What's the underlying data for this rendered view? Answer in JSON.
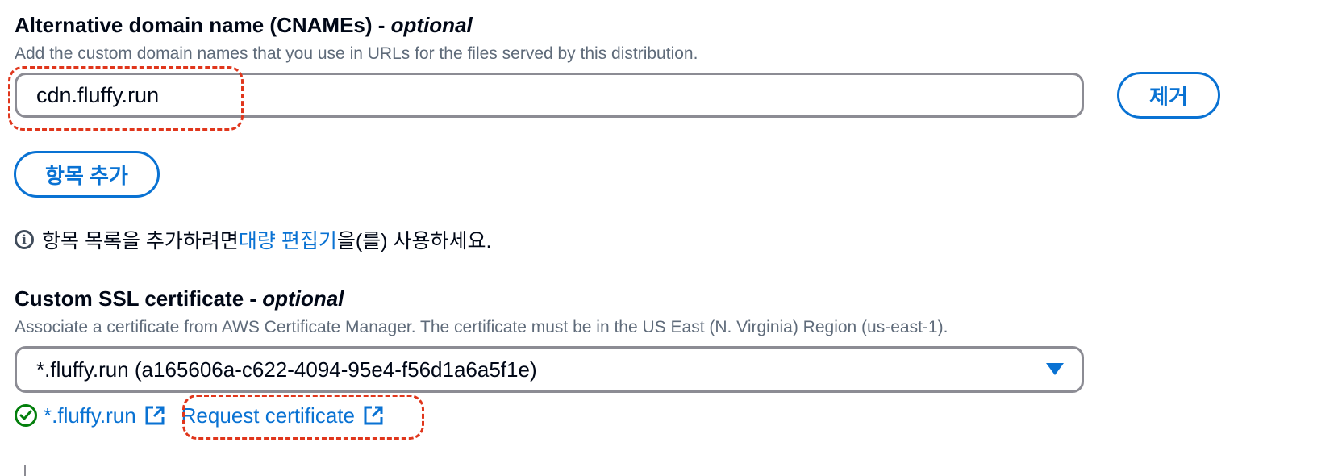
{
  "cnames": {
    "label": "Alternative domain name (CNAMEs)",
    "optional": "optional",
    "description": "Add the custom domain names that you use in URLs for the files served by this distribution.",
    "value": "cdn.fluffy.run",
    "remove_button": "제거",
    "add_button": "항목 추가"
  },
  "info": {
    "icon": "info-icon",
    "text_before": "항목 목록을 추가하려면 ",
    "link": "대량 편집기",
    "text_after": "을(를) 사용하세요."
  },
  "ssl": {
    "label": "Custom SSL certificate",
    "optional": "optional",
    "description": "Associate a certificate from AWS Certificate Manager. The certificate must be in the US East (N. Virginia) Region (us-east-1).",
    "selected": "*.fluffy.run (a165606a-c622-4094-95e4-f56d1a6a5f1e)",
    "cert_link": "*.fluffy.run",
    "request_link": "Request certificate"
  },
  "colors": {
    "link": "#0972d3",
    "success": "#037f0c",
    "annotation": "#e0361c",
    "border": "#8c8c94"
  }
}
